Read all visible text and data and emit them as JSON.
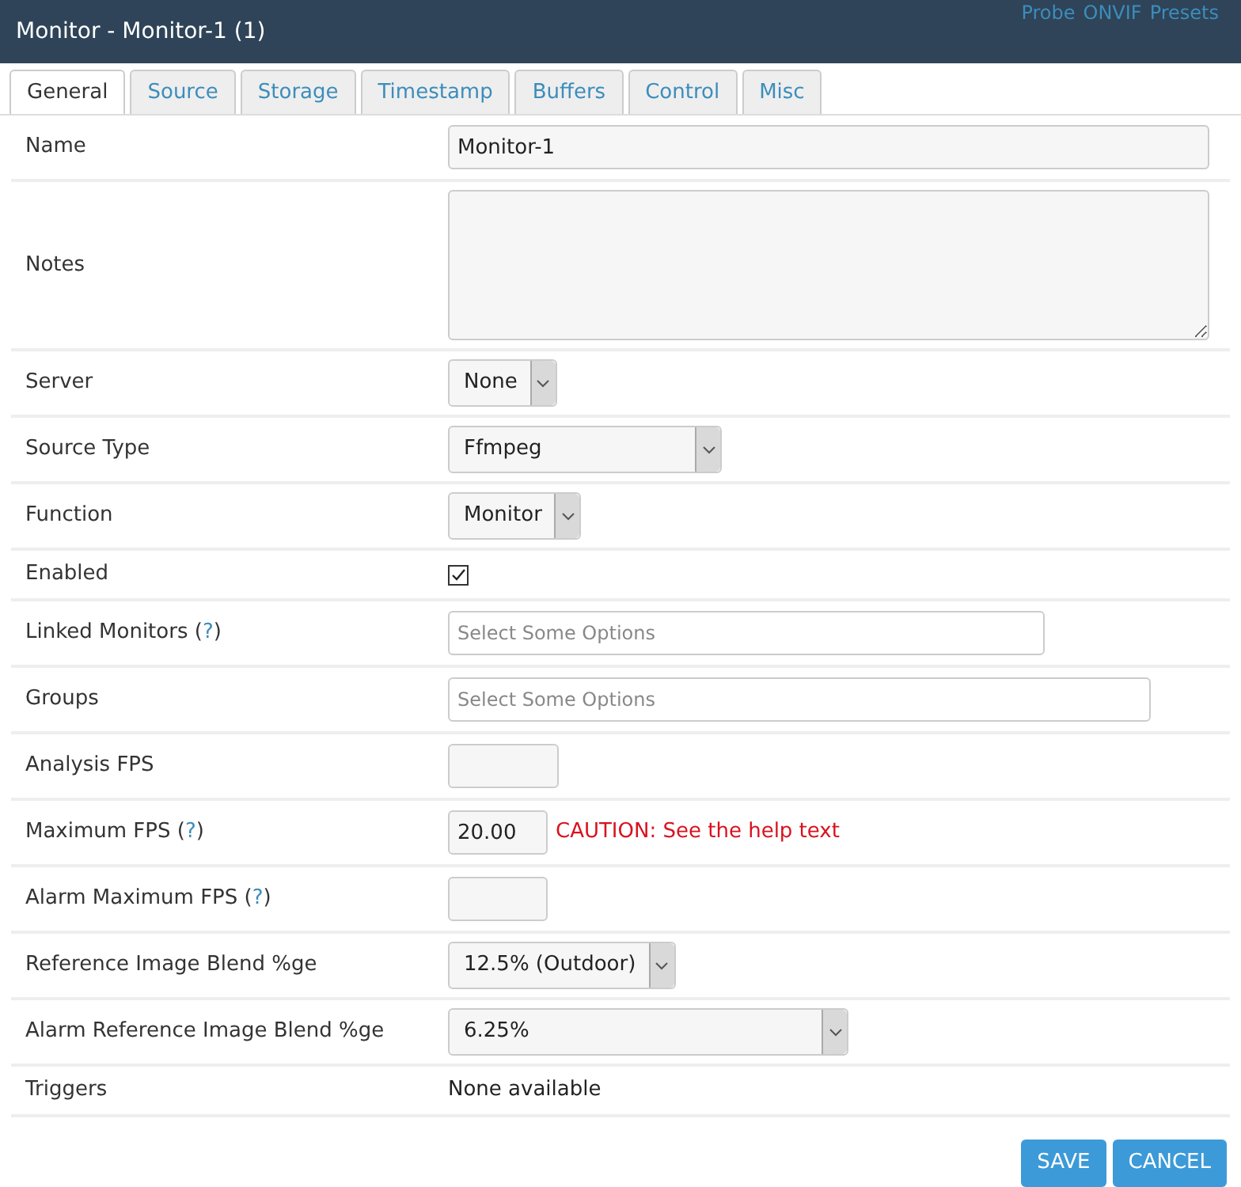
{
  "header": {
    "title": "Monitor - Monitor-1 (1)",
    "links": [
      "Probe",
      "ONVIF",
      "Presets"
    ]
  },
  "tabs": [
    {
      "label": "General",
      "selected": true
    },
    {
      "label": "Source",
      "selected": false
    },
    {
      "label": "Storage",
      "selected": false
    },
    {
      "label": "Timestamp",
      "selected": false
    },
    {
      "label": "Buffers",
      "selected": false
    },
    {
      "label": "Control",
      "selected": false
    },
    {
      "label": "Misc",
      "selected": false
    }
  ],
  "rows": [
    {
      "label": "Name",
      "kind": "text",
      "value": "Monitor-1"
    },
    {
      "label": "Notes",
      "kind": "textarea"
    },
    {
      "label": "Server",
      "kind": "select",
      "value": "None"
    },
    {
      "label": "Source Type",
      "kind": "select",
      "value": "Ffmpeg"
    },
    {
      "label": "Function",
      "kind": "select",
      "value": "Monitor"
    },
    {
      "label": "Enabled",
      "kind": "checkbox",
      "checked": true
    },
    {
      "label": "Linked Monitors",
      "help": {
        "before": "(",
        "link": "?",
        "after": ")"
      },
      "kind": "multiselect",
      "placeholder": "Select Some Options"
    },
    {
      "label": "Groups",
      "kind": "multiselect",
      "placeholder": "Select Some Options"
    },
    {
      "label": "Analysis FPS",
      "kind": "number"
    },
    {
      "label": "Maximum FPS",
      "help": {
        "before": "(",
        "link": "?",
        "after": ")"
      },
      "kind": "number",
      "value": "20.00",
      "warning": "CAUTION: See the help text"
    },
    {
      "label": "Alarm Maximum FPS",
      "help": {
        "before": "(",
        "link": "?",
        "after": ")"
      },
      "kind": "number"
    },
    {
      "label": "Reference Image Blend %ge",
      "kind": "select",
      "value": "12.5% (Outdoor)"
    },
    {
      "label": "Alarm Reference Image Blend %ge",
      "kind": "select",
      "value": "6.25%"
    },
    {
      "label": "Triggers",
      "kind": "static",
      "value": "None available"
    }
  ],
  "buttons": [
    "SAVE",
    "CANCEL"
  ]
}
